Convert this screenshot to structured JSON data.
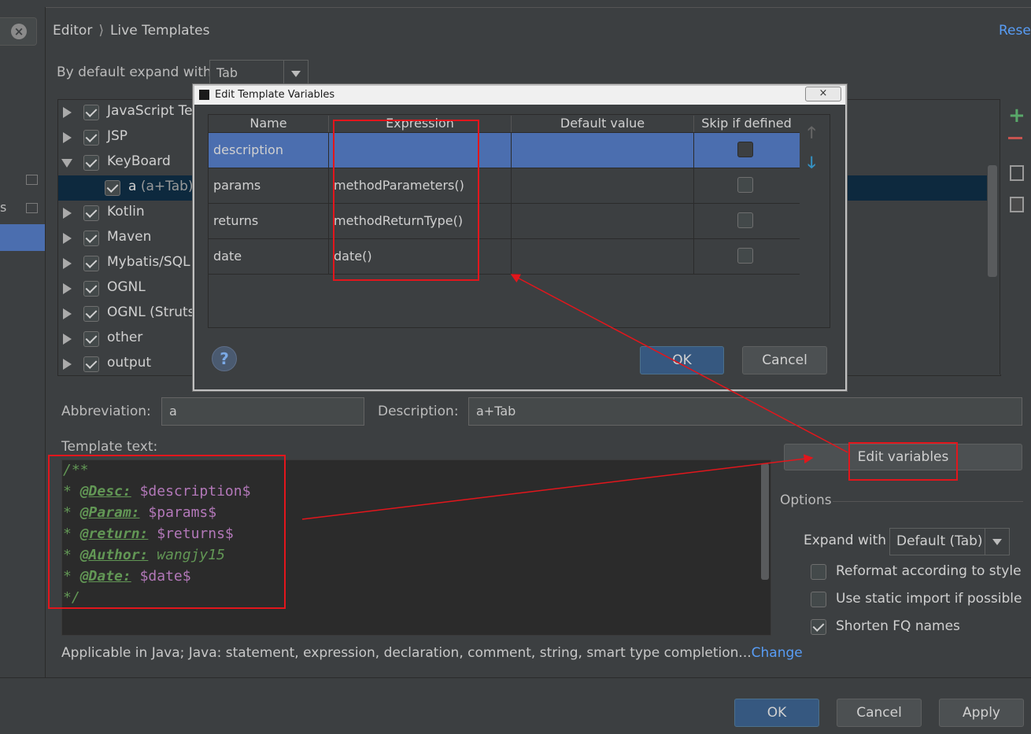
{
  "header": {
    "breadcrumb": [
      "Editor",
      "Live Templates"
    ],
    "reset_label": "Reset"
  },
  "expand": {
    "label": "By default expand with",
    "value": "Tab"
  },
  "tree": [
    {
      "label": "JavaScript Te",
      "checked": true,
      "expanded": false
    },
    {
      "label": "JSP",
      "checked": true,
      "expanded": false
    },
    {
      "label": "KeyBoard",
      "checked": true,
      "expanded": true
    },
    {
      "label": "a",
      "suffix": " (a+Tab)",
      "checked": true,
      "child": true,
      "selected": true
    },
    {
      "label": "Kotlin",
      "checked": true,
      "expanded": false
    },
    {
      "label": "Maven",
      "checked": true,
      "expanded": false
    },
    {
      "label": "Mybatis/SQL",
      "checked": true,
      "expanded": false
    },
    {
      "label": "OGNL",
      "checked": true,
      "expanded": false
    },
    {
      "label": "OGNL (Struts",
      "checked": true,
      "expanded": false
    },
    {
      "label": "other",
      "checked": true,
      "expanded": false
    },
    {
      "label": "output",
      "checked": true,
      "expanded": false
    }
  ],
  "left_pane": {
    "fragment": "s"
  },
  "abbreviation": {
    "label": "Abbreviation:",
    "value": "a"
  },
  "description": {
    "label": "Description:",
    "value": "a+Tab"
  },
  "template_text": {
    "label": "Template text:",
    "lines": [
      [
        {
          "t": "/**",
          "c": "cm"
        }
      ],
      [
        {
          "t": "* ",
          "c": "cm"
        },
        {
          "t": "@Desc:",
          "c": "tag"
        },
        {
          "t": " ",
          "c": "cm"
        },
        {
          "t": "$description$",
          "c": "var"
        }
      ],
      [
        {
          "t": "* ",
          "c": "cm"
        },
        {
          "t": "@Param:",
          "c": "tag"
        },
        {
          "t": " ",
          "c": "cm"
        },
        {
          "t": "$params$",
          "c": "var"
        }
      ],
      [
        {
          "t": "* ",
          "c": "cm"
        },
        {
          "t": "@return:",
          "c": "tag"
        },
        {
          "t": " ",
          "c": "cm"
        },
        {
          "t": "$returns$",
          "c": "var"
        }
      ],
      [
        {
          "t": "* ",
          "c": "cm"
        },
        {
          "t": "@Author:",
          "c": "tag"
        },
        {
          "t": " wangjy15",
          "c": "gr"
        }
      ],
      [
        {
          "t": "* ",
          "c": "cm"
        },
        {
          "t": "@Date:",
          "c": "tag"
        },
        {
          "t": " ",
          "c": "cm"
        },
        {
          "t": "$date$",
          "c": "var"
        }
      ],
      [
        {
          "t": "*/",
          "c": "cm"
        }
      ]
    ]
  },
  "edit_variables_label": "Edit variables",
  "options": {
    "title": "Options",
    "expand_with_label": "Expand with",
    "expand_with_value": "Default (Tab)",
    "checkboxes": [
      {
        "label": "Reformat according to style",
        "checked": false
      },
      {
        "label": "Use static import if possible",
        "checked": false
      },
      {
        "label": "Shorten FQ names",
        "checked": true
      }
    ]
  },
  "applicable": {
    "text": "Applicable in Java; Java: statement, expression, declaration, comment, string, smart type completion...",
    "link": "Change"
  },
  "footer": {
    "ok": "OK",
    "cancel": "Cancel",
    "apply": "Apply"
  },
  "dialog": {
    "title": "Edit Template Variables",
    "close": "×",
    "columns": [
      "Name",
      "Expression",
      "Default value",
      "Skip if defined"
    ],
    "rows": [
      {
        "name": "description",
        "expression": "",
        "default": "",
        "skip": false
      },
      {
        "name": "params",
        "expression": "methodParameters()",
        "default": "",
        "skip": false
      },
      {
        "name": "returns",
        "expression": "methodReturnType()",
        "default": "",
        "skip": false
      },
      {
        "name": "date",
        "expression": "date()",
        "default": "",
        "skip": false
      }
    ],
    "help": "?",
    "ok": "OK",
    "cancel": "Cancel"
  },
  "colors": {
    "annotation_red": "#e2161c",
    "selection": "#4b6eaf",
    "link": "#589df6"
  }
}
